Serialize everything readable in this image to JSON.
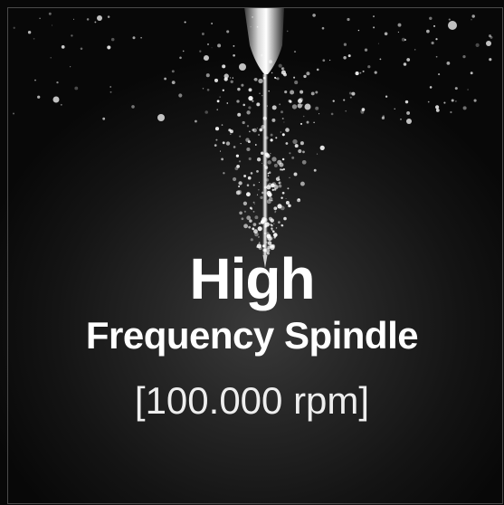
{
  "title": "High",
  "subtitle": "Frequency Spindle",
  "spec": "[100.000 rpm]",
  "colors": {
    "background": "#0b0b0b",
    "text": "#ffffff",
    "border": "#4a4a4a"
  },
  "icons": [
    "spindle-needle-icon",
    "water-spray-particles"
  ]
}
